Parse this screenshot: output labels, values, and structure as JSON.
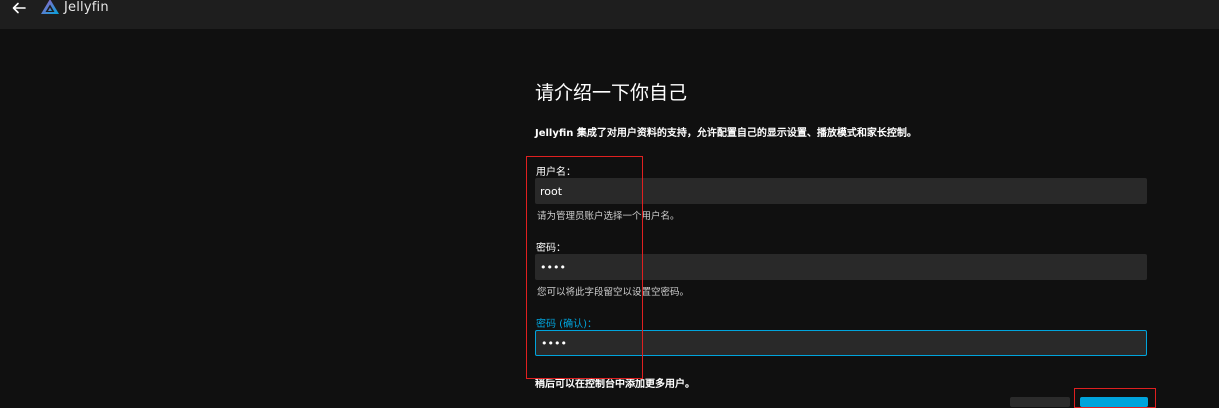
{
  "header": {
    "app_name": "Jellyfin",
    "back_icon": "arrow-left-icon",
    "logo_icon": "jellyfin-logo-icon"
  },
  "page": {
    "title": "请介绍一下你自己",
    "intro": "Jellyfin 集成了对用户资料的支持，允许配置自己的显示设置、播放模式和家长控制。",
    "footer_note": "稍后可以在控制台中添加更多用户。"
  },
  "form": {
    "username": {
      "label": "用户名：",
      "value": "root",
      "help": "请为管理员账户选择一个用户名。"
    },
    "password": {
      "label": "密码：",
      "value": "••••",
      "help": "您可以将此字段留空以设置空密码。"
    },
    "password_confirm": {
      "label": "密码 (确认)：",
      "value": "••••"
    }
  },
  "colors": {
    "accent": "#00a4dc",
    "highlight_box": "#e02020",
    "background": "#101010",
    "header": "#1e1e1e",
    "input": "#292929"
  }
}
